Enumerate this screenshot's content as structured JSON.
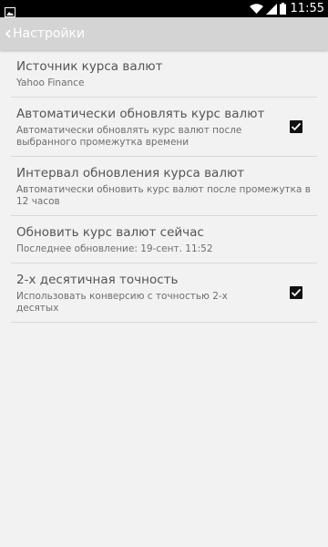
{
  "status_bar": {
    "time": "11:55",
    "left_icon": "image-notification-icon",
    "icons": [
      "wifi-icon",
      "signal-icon",
      "battery-icon"
    ]
  },
  "action_bar": {
    "title": "Настройки",
    "up_icon": "chevron-left-icon"
  },
  "preferences": [
    {
      "title": "Источник курса валют",
      "summary": "Yahoo Finance"
    },
    {
      "title": "Автоматически обновлять курс валют",
      "summary": "Автоматически обновлять курс валют после выбранного промежутка времени",
      "checked": true
    },
    {
      "title": "Интервал обновления курса валют",
      "summary": "Автоматически обновить курс валют после промежутка в 12 часов"
    },
    {
      "title": "Обновить курс валют сейчас",
      "summary": "Последнее обновление: 19-сент. 11:52"
    },
    {
      "title": "2-х десятичная точность",
      "summary": "Использовать конверсию с точностью 2-х десятых",
      "checked": true
    }
  ],
  "colors": {
    "background": "#f2f2f2",
    "action_bar": "#d4d4d4",
    "divider": "#d9d9d9"
  }
}
